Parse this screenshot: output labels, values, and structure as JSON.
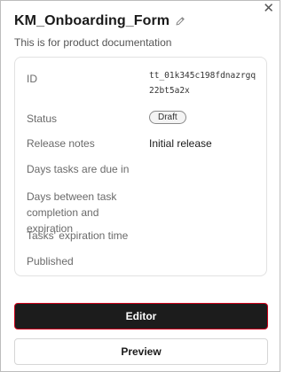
{
  "header": {
    "title": "KM_Onboarding_Form",
    "description": "This is for product documentation"
  },
  "details": {
    "id_label": "ID",
    "id_value": "tt_01k345c198fdnazrgq22bt5a2x",
    "status_label": "Status",
    "status_value": "Draft",
    "release_notes_label": "Release notes",
    "release_notes_value": "Initial release",
    "days_due_label": "Days tasks are due in",
    "days_expiration_label": "Days between task completion and expiration",
    "expiration_time_label": "Tasks' expiration time",
    "published_label": "Published"
  },
  "buttons": {
    "editor": "Editor",
    "preview": "Preview"
  },
  "icons": {
    "close": "close-icon",
    "edit": "pencil-icon"
  }
}
